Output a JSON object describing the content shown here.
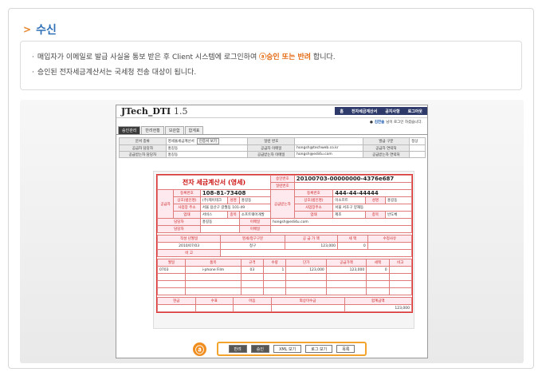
{
  "section": {
    "title": "수신"
  },
  "notes": [
    {
      "text": "매입자가 이메일로 발급 사실을 통보 받은 후 Client 시스템에 로그인하여 ",
      "highlight": "ⓐ승인 또는 반려",
      "tail": " 합니다."
    },
    {
      "text": "승인된 전자세금계산서는 국세청 전송 대상이 됩니다.",
      "highlight": "",
      "tail": ""
    }
  ],
  "app": {
    "logo": "JTech_DTI",
    "version": "1.5",
    "nav": [
      "홈",
      "전자세금계산서",
      "공지사항",
      "로그아웃"
    ],
    "user_name": "김한솔",
    "user_greeting": "님이 로그인 하셨습니다.",
    "tabs": [
      "승인관리",
      "반려현황",
      "보관함",
      "합계표"
    ],
    "meta": {
      "row1": [
        "문서 종류",
        "영세율세금계산서",
        "인증서 보기",
        "일련 번호",
        "",
        "발급 구분",
        "정상"
      ],
      "row2": [
        "공급자 담당자",
        "홍길동",
        "공급자 이메일",
        "hongsh@techweb.co.kr",
        "공급자 연락처",
        ""
      ],
      "row3": [
        "공급받는자 담당자",
        "홍길동",
        "공급받는자 이메일",
        "hongsh@edi4u.com",
        "공급받는자 연락처",
        ""
      ]
    },
    "invoice": {
      "title": "전자 세금계산서 (영세)",
      "approval_no_label": "승인번호",
      "approval_no": "20100703-00000000-4376e687",
      "serial_label": "일련번호",
      "supplier": {
        "reg_label": "등록번호",
        "reg": "108-81-73408",
        "company_label": "상호(법인명)",
        "company": "(주)제이테크",
        "rep_label": "성명",
        "rep": "홍길동",
        "addr_label": "사업장 주소",
        "addr": "서울 용산구 갈월동 101-49",
        "biz_label": "업태",
        "biz": "서비스",
        "item_label": "종목",
        "item": "소프트웨어개발"
      },
      "buyer": {
        "reg_label": "등록번호",
        "reg": "444-44-44444",
        "company_label": "상호(법인명)",
        "company": "이소프트",
        "rep_label": "성명",
        "rep": "홍길동",
        "addr_label": "사업장주소",
        "addr": "서울 서초구 양재동",
        "biz_label": "업태",
        "biz": "제조",
        "item_label": "종목",
        "item": "반도체"
      },
      "contact_label": "담당자",
      "contact": "홍길동",
      "email_label": "이메일",
      "email": "hongsh@edi4u.com",
      "contact2_label": "담당자",
      "email2_label": "이메일",
      "summary_headers": [
        "작성 년월일",
        "영세/청구구분",
        "공 급 가 액",
        "세 액",
        "수정사유"
      ],
      "summary_row": [
        "2010/07/03",
        "청구",
        "123,000",
        "0",
        ""
      ],
      "remark_label": "비 고",
      "item_headers": [
        "월일",
        "품목",
        "규격",
        "수량",
        "단가",
        "공급가액",
        "세액",
        "비고"
      ],
      "item_row": [
        "0703",
        "i-phone Film",
        "03",
        "1",
        "123,000",
        "123,000",
        "0",
        ""
      ],
      "total_headers": [
        "현금",
        "수표",
        "어음",
        "외상미수금",
        "합계금액"
      ],
      "total_row": [
        "",
        "",
        "",
        "",
        "123,000"
      ]
    },
    "buttons": [
      "반려",
      "승인",
      "XML 보기",
      "로그 보기",
      "목록"
    ]
  },
  "marker": "ⓐ"
}
